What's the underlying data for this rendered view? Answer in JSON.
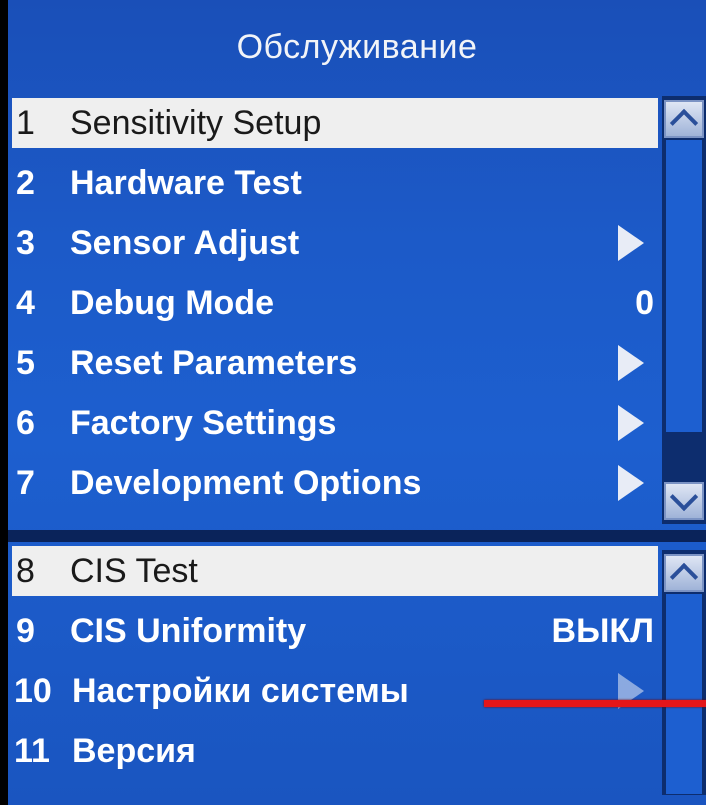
{
  "header": {
    "title": "Обслуживание"
  },
  "menu_top": {
    "items": [
      {
        "num": "1",
        "label": "Sensitivity Setup",
        "value": "",
        "submenu": false,
        "selected": true
      },
      {
        "num": "2",
        "label": "Hardware Test",
        "value": "",
        "submenu": false,
        "selected": false
      },
      {
        "num": "3",
        "label": "Sensor Adjust",
        "value": "",
        "submenu": true,
        "selected": false
      },
      {
        "num": "4",
        "label": "Debug Mode",
        "value": "0",
        "submenu": false,
        "selected": false
      },
      {
        "num": "5",
        "label": "Reset Parameters",
        "value": "",
        "submenu": true,
        "selected": false
      },
      {
        "num": "6",
        "label": "Factory Settings",
        "value": "",
        "submenu": true,
        "selected": false
      },
      {
        "num": "7",
        "label": "Development Options",
        "value": "",
        "submenu": true,
        "selected": false
      }
    ]
  },
  "menu_bottom": {
    "items": [
      {
        "num": "8",
        "label": "CIS Test",
        "value": "",
        "submenu": false,
        "selected": true
      },
      {
        "num": "9",
        "label": "CIS Uniformity",
        "value": "ВЫКЛ",
        "submenu": false,
        "selected": false
      },
      {
        "num": "10",
        "label": "Настройки системы",
        "value": "",
        "submenu": true,
        "selected": false
      },
      {
        "num": "11",
        "label": "Версия",
        "value": "",
        "submenu": false,
        "selected": false
      }
    ]
  },
  "annotation": {
    "color": "#e4161a"
  }
}
